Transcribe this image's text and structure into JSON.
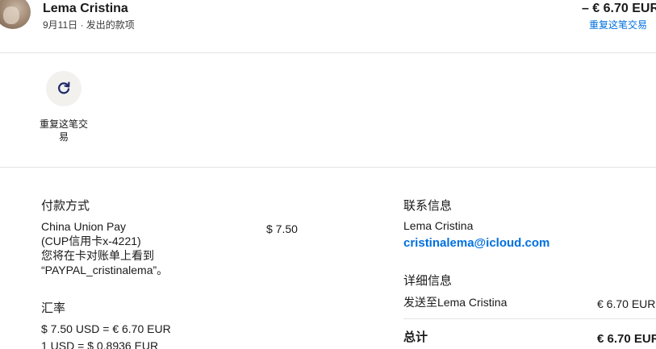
{
  "header": {
    "name": "Lema Cristina",
    "meta": "9月11日 · 发出的款项",
    "amount": "– € 6.70 EUR",
    "repeat_link": "重复这笔交易"
  },
  "actions": {
    "repeat_label": "重复这笔交易"
  },
  "payment": {
    "title": "付款方式",
    "method_line1": "China Union Pay",
    "method_line2": "(CUP信用卡x-4221)",
    "statement_line1": "您将在卡对账单上看到",
    "statement_line2": "“PAYPAL_cristinalema”。",
    "amount": "$ 7.50"
  },
  "exchange": {
    "title": "汇率",
    "line1": "$ 7.50 USD = € 6.70 EUR",
    "line2": "1 USD = $ 0.8936 EUR"
  },
  "contact": {
    "title": "联系信息",
    "name": "Lema Cristina",
    "email": "cristinalema@icloud.com"
  },
  "details": {
    "title": "详细信息",
    "sent_to_label": "发送至Lema Cristina",
    "sent_to_amount": "€ 6.70 EUR",
    "total_label": "总计",
    "total_amount": "€ 6.70 EUR"
  },
  "colors": {
    "accent": "#0070e0",
    "icon_navy": "#1d2a6b",
    "circle_bg": "#f2f1ee"
  },
  "icons": {
    "repeat": "refresh-icon"
  }
}
